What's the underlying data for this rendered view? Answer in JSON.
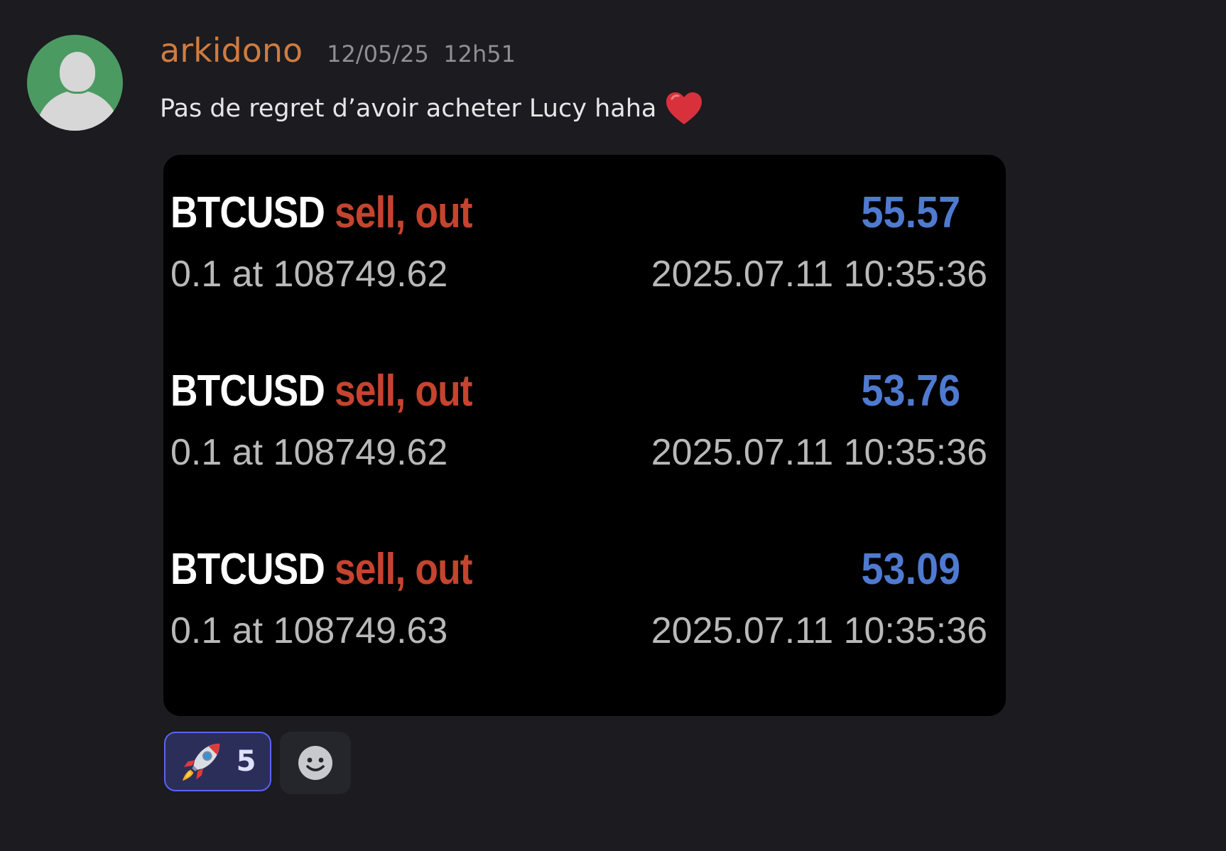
{
  "message": {
    "username": "arkidono",
    "timestamp": "12/05/25  12h51",
    "text": "Pas de regret d’avoir acheter Lucy haha",
    "emoji_icon": "red-heart-icon",
    "avatar_icon": "default-user-avatar-icon"
  },
  "trades": [
    {
      "ticker": "BTCUSD",
      "side": "sell, out",
      "profit": "55.57",
      "quantity": "0.1 at 108749.62",
      "datetime": "2025.07.11 10:35:36"
    },
    {
      "ticker": "BTCUSD",
      "side": "sell, out",
      "profit": "53.76",
      "quantity": "0.1 at 108749.62",
      "datetime": "2025.07.11 10:35:36"
    },
    {
      "ticker": "BTCUSD",
      "side": "sell, out",
      "profit": "53.09",
      "quantity": "0.1 at 108749.63",
      "datetime": "2025.07.11 10:35:36"
    }
  ],
  "reactions": [
    {
      "emoji_icon": "rocket-icon",
      "count": "5"
    }
  ],
  "add_reaction_icon": "add-reaction-smiley-icon",
  "colors": {
    "background": "#1b1b20",
    "username": "#cf7c3f",
    "sell": "#c5442f",
    "profit": "#4f7ad0",
    "reaction_border": "#5865f2"
  }
}
